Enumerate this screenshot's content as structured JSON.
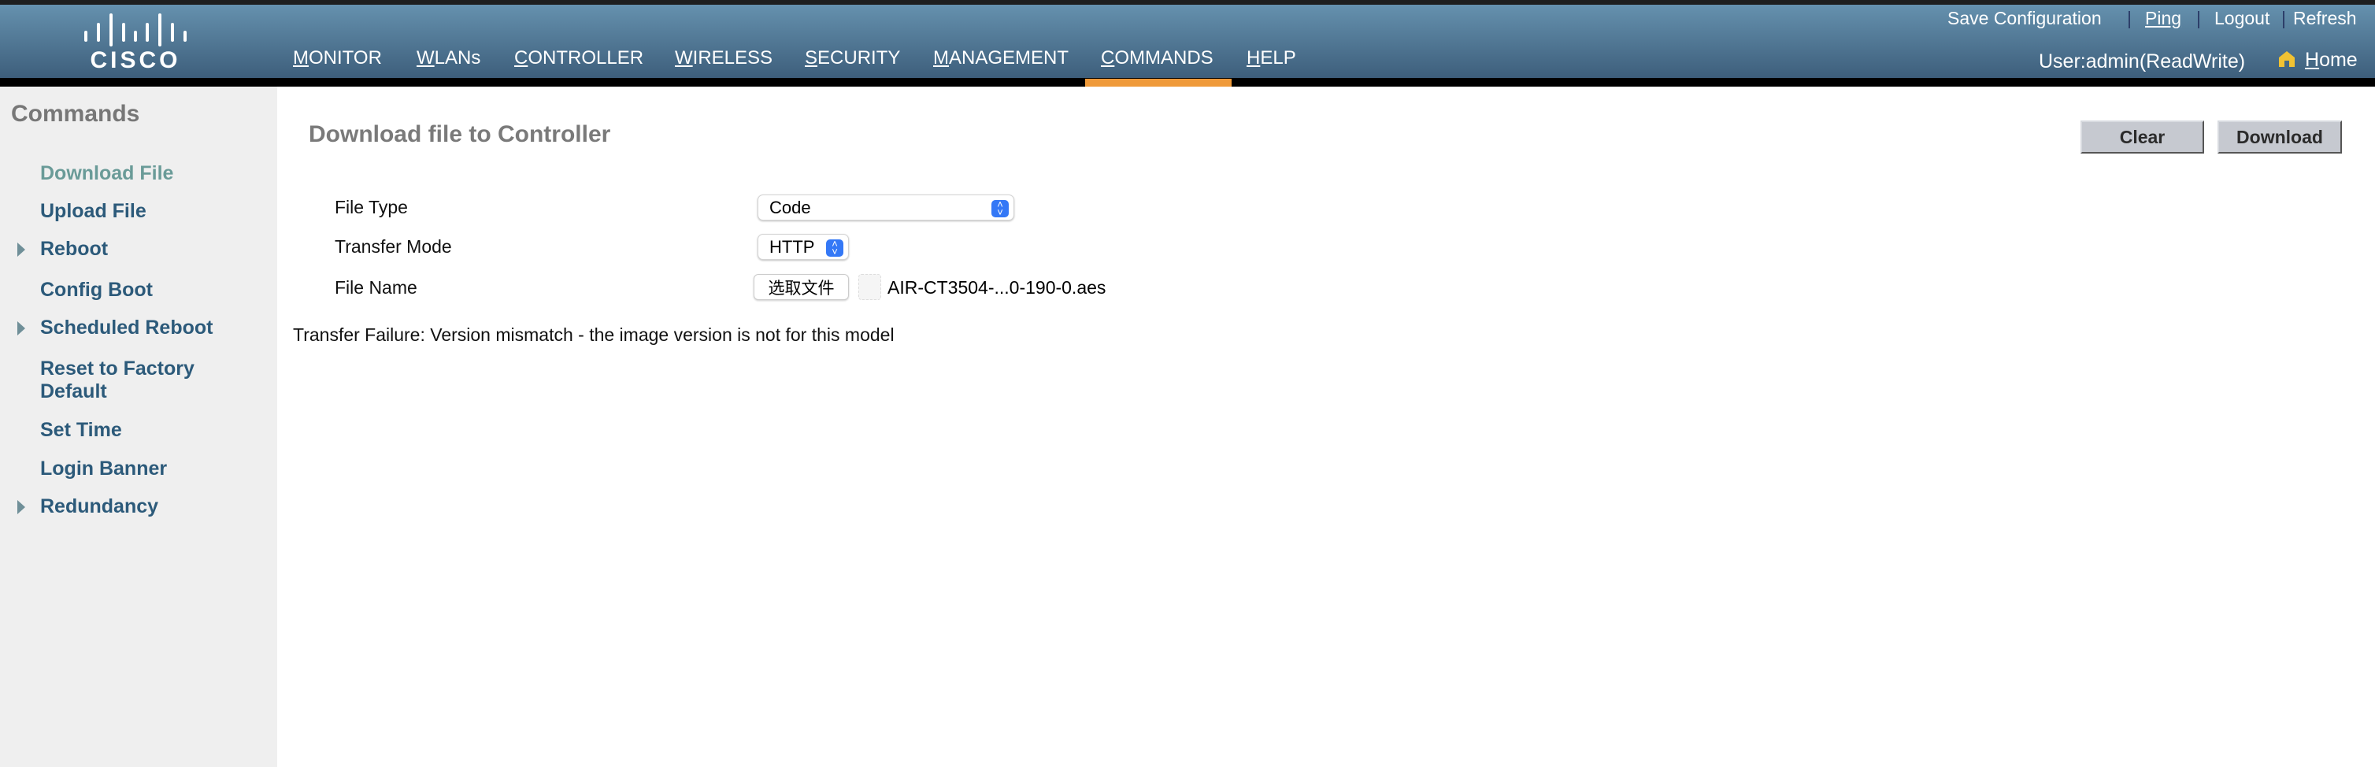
{
  "header": {
    "logo_text": "CISCO",
    "nav": [
      "MONITOR",
      "WLANs",
      "CONTROLLER",
      "WIRELESS",
      "SECURITY",
      "MANAGEMENT",
      "COMMANDS",
      "HELP"
    ],
    "active_nav": "COMMANDS",
    "links": {
      "save": "Save Configuration",
      "ping": "Ping",
      "logout": "Logout",
      "refresh": "Refresh",
      "sep": "|"
    },
    "user": "User:admin(ReadWrite)",
    "home": "Home"
  },
  "sidebar": {
    "title": "Commands",
    "items": [
      {
        "label": "Download File",
        "active": true
      },
      {
        "label": "Upload File"
      },
      {
        "label": "Reboot",
        "expandable": true
      },
      {
        "label": "Config Boot"
      },
      {
        "label": "Scheduled Reboot",
        "expandable": true
      },
      {
        "label": "Reset to Factory Default"
      },
      {
        "label": "Set Time"
      },
      {
        "label": "Login Banner"
      },
      {
        "label": "Redundancy",
        "expandable": true
      }
    ]
  },
  "main": {
    "title": "Download file to Controller",
    "clear_label": "Clear",
    "download_label": "Download",
    "form": {
      "file_type_label": "File Type",
      "file_type_value": "Code",
      "transfer_mode_label": "Transfer Mode",
      "transfer_mode_value": "HTTP",
      "file_name_label": "File Name",
      "choose_file_label": "选取文件",
      "file_name_value": "AIR-CT3504-...0-190-0.aes"
    },
    "error": "Transfer Failure: Version mismatch - the image version is not for this model"
  },
  "colors": {
    "accent": "#ef9a3a",
    "link": "#2c5a7a"
  }
}
